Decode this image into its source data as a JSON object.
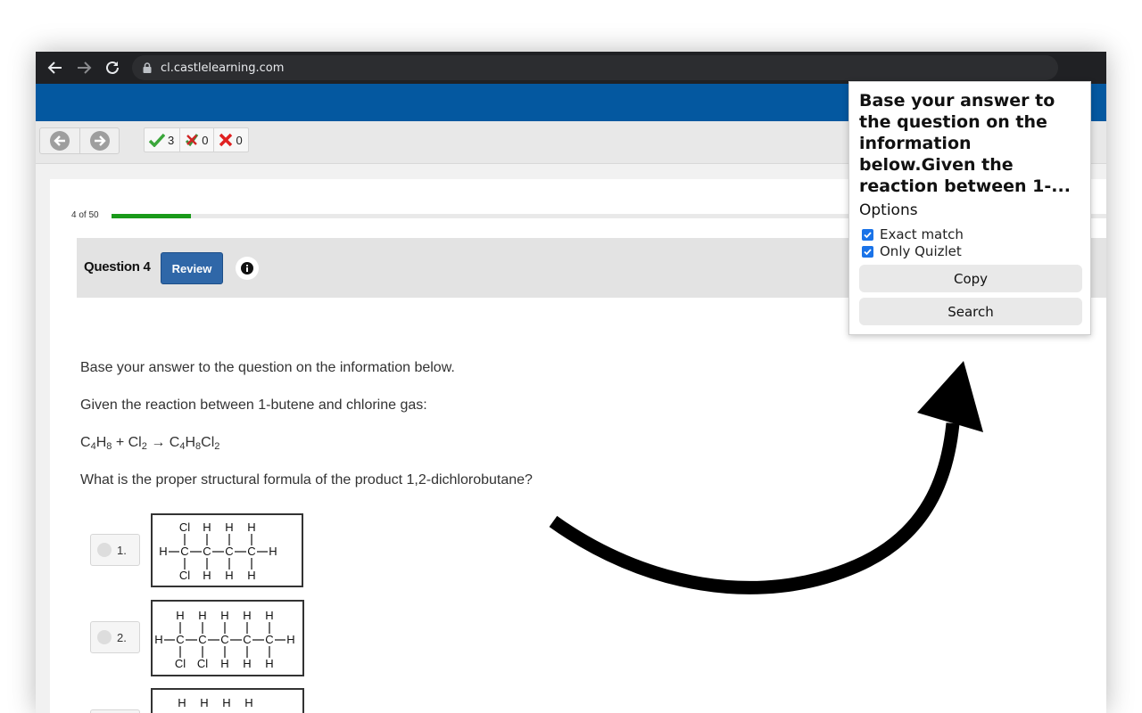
{
  "browser": {
    "url": "cl.castlelearning.com",
    "icons": [
      "back-arrow-icon",
      "forward-arrow-icon",
      "reload-icon",
      "lock-icon"
    ]
  },
  "toolbar": {
    "scores": [
      {
        "icon": "check-icon",
        "value": "3",
        "color": "#3aa63a"
      },
      {
        "icon": "partial-x-icon",
        "value": "0",
        "color": "#3f8f3a"
      },
      {
        "icon": "x-icon",
        "value": "0",
        "color": "#e02020"
      }
    ]
  },
  "progress": {
    "label": "4 of 50",
    "fraction": 0.08
  },
  "question": {
    "title": "Question 4",
    "review_label": "Review",
    "intro": "Base your answer to the question on the information below.",
    "given": "Given the reaction between 1-butene and chlorine gas:",
    "equation": {
      "reactant1": "C4H8",
      "plus": "+",
      "reactant2": "Cl2",
      "arrow": "→",
      "product": "C4H8Cl2"
    },
    "prompt": "What is the proper structural formula of the product 1,2-dichlorobutane?",
    "choices": [
      {
        "label": "1.",
        "top": [
          "Cl",
          "H",
          "H",
          "H"
        ],
        "left": "H",
        "chain": [
          "C",
          "C",
          "C",
          "C"
        ],
        "right": "H",
        "bottom": [
          "Cl",
          "H",
          "H",
          "H"
        ]
      },
      {
        "label": "2.",
        "top": [
          "H",
          "H",
          "H",
          "H",
          "H"
        ],
        "left": "H",
        "chain": [
          "C",
          "C",
          "C",
          "C",
          "C"
        ],
        "right": "H",
        "bottom": [
          "Cl",
          "Cl",
          "H",
          "H",
          "H"
        ]
      },
      {
        "label": "",
        "top": [
          "H",
          "H",
          "H",
          "H"
        ]
      }
    ]
  },
  "popup": {
    "title": "Base your answer to the question on the information below.Given the reaction between 1-...",
    "options_heading": "Options",
    "exact_match_label": "Exact match",
    "only_quizlet_label": "Only Quizlet",
    "copy_label": "Copy",
    "search_label": "Search",
    "checkbox_color": "#1a73e8"
  }
}
